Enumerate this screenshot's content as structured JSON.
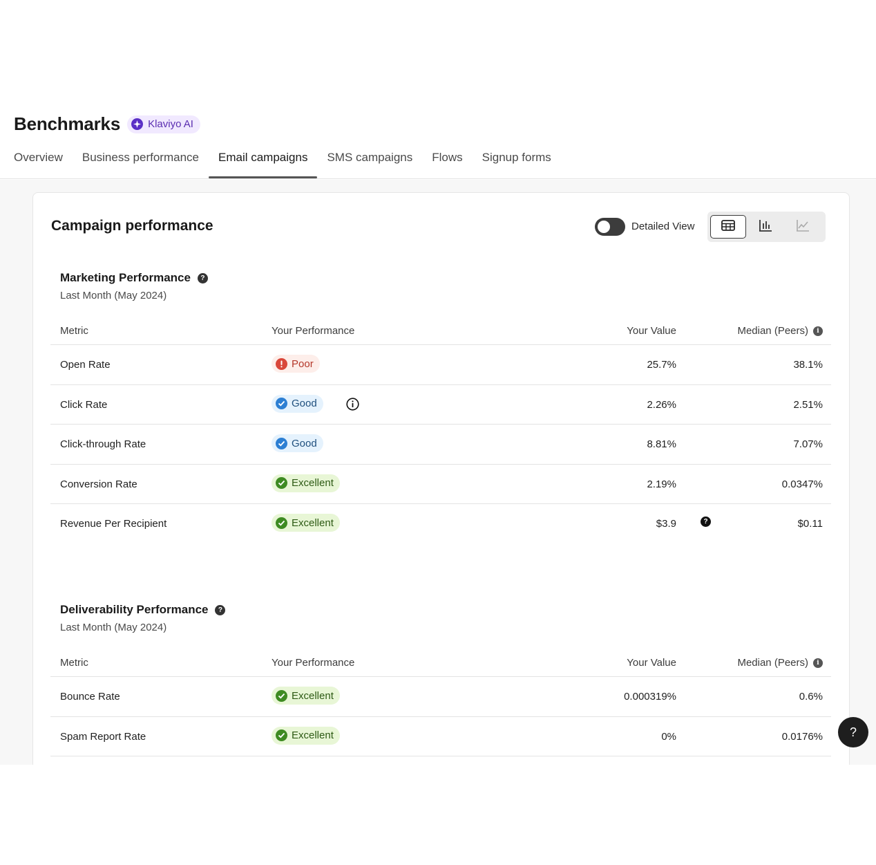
{
  "header": {
    "title": "Benchmarks",
    "ai_badge": "Klaviyo AI",
    "tabs": [
      {
        "label": "Overview"
      },
      {
        "label": "Business performance"
      },
      {
        "label": "Email campaigns",
        "active": true
      },
      {
        "label": "SMS campaigns"
      },
      {
        "label": "Flows"
      },
      {
        "label": "Signup forms"
      }
    ]
  },
  "card": {
    "title": "Campaign performance",
    "toggle_label": "Detailed View",
    "toggle_on": false,
    "view_buttons": [
      "table-icon",
      "bar-chart-icon",
      "line-chart-icon"
    ],
    "active_view": "table"
  },
  "columns": {
    "metric": "Metric",
    "performance": "Your Performance",
    "value": "Your Value",
    "median": "Median (Peers)"
  },
  "marketing": {
    "title": "Marketing Performance",
    "subtitle": "Last Month (May 2024)",
    "rows": [
      {
        "metric": "Open Rate",
        "rating": "Poor",
        "value": "25.7%",
        "median": "38.1%"
      },
      {
        "metric": "Click Rate",
        "rating": "Good",
        "value": "2.26%",
        "median": "2.51%"
      },
      {
        "metric": "Click-through Rate",
        "rating": "Good",
        "value": "8.81%",
        "median": "7.07%"
      },
      {
        "metric": "Conversion Rate",
        "rating": "Excellent",
        "value": "2.19%",
        "median": "0.0347%"
      },
      {
        "metric": "Revenue Per Recipient",
        "rating": "Excellent",
        "value": "$3.9",
        "median": "$0.11"
      }
    ]
  },
  "deliverability": {
    "title": "Deliverability Performance",
    "subtitle": "Last Month (May 2024)",
    "rows": [
      {
        "metric": "Bounce Rate",
        "rating": "Excellent",
        "value": "0.000319%",
        "median": "0.6%"
      },
      {
        "metric": "Spam Report Rate",
        "rating": "Excellent",
        "value": "0%",
        "median": "0.0176%"
      }
    ]
  },
  "help_button": "?",
  "colors": {
    "poor": "#d9473a",
    "good": "#2d7fd3",
    "excellent": "#3e8b22",
    "ai_purple": "#5b30c6"
  }
}
